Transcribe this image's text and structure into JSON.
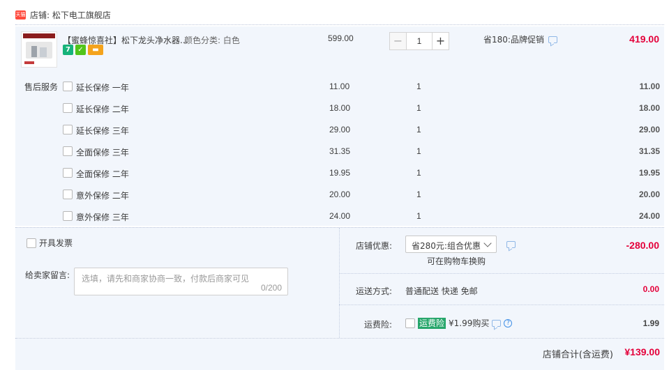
{
  "shop": {
    "logo_text": "天猫",
    "name": "店铺: 松下电工旗舰店"
  },
  "item": {
    "title": "【蜜蜂惊喜社】松下龙头净水器...",
    "sku": "颜色分类: 白色",
    "badge_7": "7",
    "price": "599.00",
    "quantity": "1",
    "qty_minus": "−",
    "qty_plus": "+",
    "promotion": "省180:品牌促销",
    "subtotal": "419.00"
  },
  "services": {
    "label": "售后服务",
    "rows": [
      {
        "name": "延长保修 一年",
        "price": "11.00",
        "qty": "1",
        "sum": "11.00"
      },
      {
        "name": "延长保修 二年",
        "price": "18.00",
        "qty": "1",
        "sum": "18.00"
      },
      {
        "name": "延长保修 三年",
        "price": "29.00",
        "qty": "1",
        "sum": "29.00"
      },
      {
        "name": "全面保修 三年",
        "price": "31.35",
        "qty": "1",
        "sum": "31.35"
      },
      {
        "name": "全面保修 二年",
        "price": "19.95",
        "qty": "1",
        "sum": "19.95"
      },
      {
        "name": "意外保修 二年",
        "price": "20.00",
        "qty": "1",
        "sum": "20.00"
      },
      {
        "name": "意外保修 三年",
        "price": "24.00",
        "qty": "1",
        "sum": "24.00"
      }
    ]
  },
  "invoice": {
    "label": "开具发票"
  },
  "message": {
    "label": "给卖家留言:",
    "placeholder": "选填，请先和商家协商一致，付款后商家可见",
    "count": "0/200"
  },
  "discount": {
    "label": "店铺优惠:",
    "selected": "省280元:组合优惠",
    "note": "可在购物车换购",
    "amount": "-280.00"
  },
  "shipping": {
    "label": "运送方式:",
    "value": "普通配送 快递 免邮",
    "amount": "0.00"
  },
  "insurance": {
    "label": "运费险:",
    "tag": "运费险",
    "text": "¥1.99购买",
    "amount": "1.99"
  },
  "total": {
    "label": "店铺合计(含运费)",
    "value": "¥139.00"
  },
  "colors": {
    "accent_red": "#e4003a",
    "panel_bg": "#f2f6fc",
    "insurance_green": "#27a66b"
  }
}
